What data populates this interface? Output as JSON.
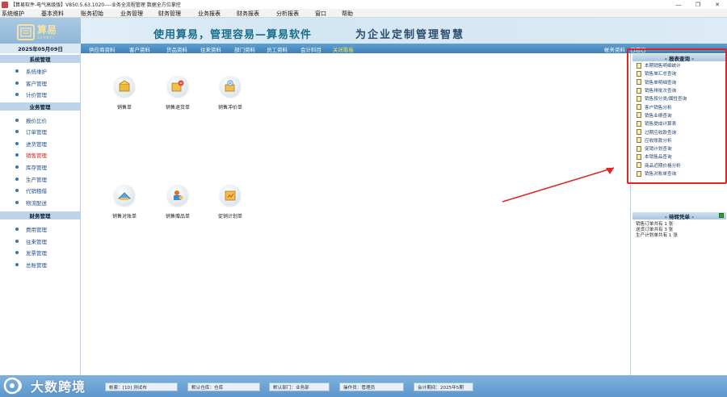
{
  "window": {
    "title": "【算易软件-电气高级版】V850.5.63.1020----业务全流程管理 数据全方位掌控",
    "controls": [
      "—",
      "❐",
      "✕"
    ]
  },
  "menu": [
    "系统维护",
    "基本资料",
    "账务初始",
    "业务管理",
    "财务管理",
    "业务报表",
    "财务报表",
    "分析报表",
    "窗口",
    "帮助"
  ],
  "banner": {
    "logo_name": "算易",
    "logo_sub": "SUANYI",
    "slogan": "使用算易，管理容易—算易软件",
    "slogan2": "为企业定制管理智慧"
  },
  "nav": {
    "date": "2025年05月09日",
    "items": [
      "供应商资料",
      "客户资料",
      "货品资料",
      "往来资料",
      "部门资料",
      "员工资料",
      "会计科目",
      "关闭看板"
    ],
    "active_index": 7,
    "right": "帐务资料 · 日志日"
  },
  "sidebar": {
    "sections": [
      {
        "title": "系统管理",
        "items": [
          "系统维护",
          "客户管理",
          "计价管理"
        ]
      },
      {
        "title": "业务管理",
        "items": [
          "报价比价",
          "订单管理",
          "进货管理",
          "销售管理",
          "库存管理",
          "生产管理",
          "代销租借",
          "物流配送"
        ]
      },
      {
        "title": "财务管理",
        "items": [
          "费用管理",
          "往来管理",
          "发票管理",
          "总账管理"
        ]
      }
    ],
    "active_item": "销售管理"
  },
  "main": {
    "tiles": [
      {
        "label": "销售单",
        "icon": "sales-order-icon"
      },
      {
        "label": "销售退货单",
        "icon": "sales-return-icon"
      },
      {
        "label": "销售冲价单",
        "icon": "sales-adjust-icon"
      },
      {
        "label": "销售对账单",
        "icon": "sales-statement-icon"
      },
      {
        "label": "销售赠品单",
        "icon": "sales-gift-icon"
      },
      {
        "label": "促销计划单",
        "icon": "promotion-plan-icon"
      }
    ]
  },
  "report_panel": {
    "title": "- 报表查询 -",
    "items": [
      "本期销售明细统计",
      "销售单汇总查询",
      "销售单明细查询",
      "销售排批次查询",
      "销售按分类/属性查询",
      "客户销售分析",
      "销售业绩查询",
      "销售提成计算表",
      "过期应收款查询",
      "应收账款分析",
      "促销计划查询",
      "本销售品查询",
      "商品近期价格分析",
      "销售对账单查询"
    ]
  },
  "pending_panel": {
    "title": "- 待转凭单 -",
    "items": [
      "销售订单共有 1 张",
      "送货订单共有 3 张",
      "生产计划单共有 1 张"
    ]
  },
  "status": {
    "account": "帐套：[10] 测试布",
    "warehouse": "默认仓库：仓库",
    "department": "默认部门：业务部",
    "operator": "操作员：管理员",
    "period": "会计期间：2025年5期"
  },
  "watermark": {
    "text": "大数跨境"
  }
}
